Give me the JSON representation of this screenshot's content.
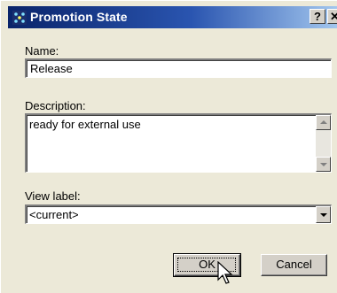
{
  "window": {
    "title": "Promotion State",
    "help_label": "?",
    "close_label": "✕"
  },
  "form": {
    "name_label": "Name:",
    "name_value": "Release",
    "description_label": "Description:",
    "description_value": "ready for external use",
    "view_label_label": "View label:",
    "view_label_value": "<current>"
  },
  "buttons": {
    "ok_label": "OK",
    "cancel_label": "Cancel"
  },
  "icons": {
    "app": "promotion-state-icon",
    "scroll_up": "scroll-up-arrow-icon",
    "scroll_down": "scroll-down-arrow-icon",
    "dropdown": "chevron-down-icon",
    "cursor": "mouse-pointer-icon"
  },
  "colors": {
    "titlebar_start": "#0a246a",
    "titlebar_end": "#a6caf0",
    "dialog_bg": "#ece9d8"
  }
}
